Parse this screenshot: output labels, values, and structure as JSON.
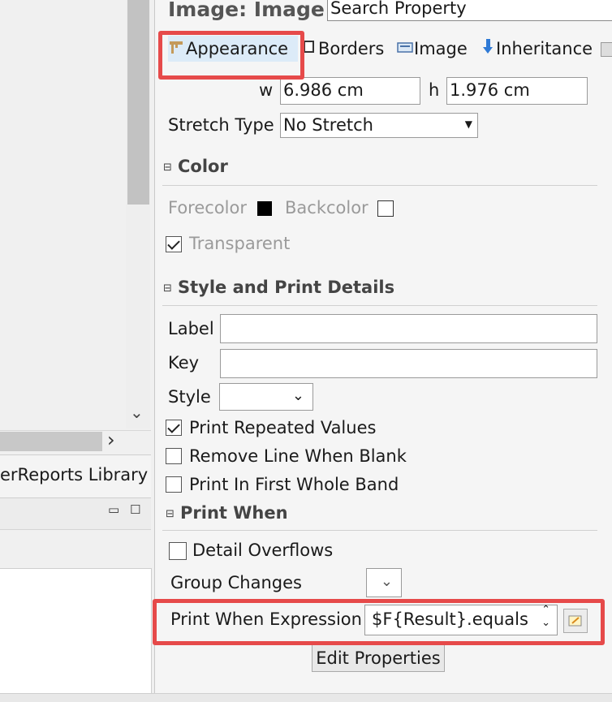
{
  "left": {
    "library_tab_label": "erReports Library",
    "scroll_down_glyph": "⌄",
    "scroll_right_glyph": "›",
    "minimize_glyph": "▭",
    "maximize_glyph": "☐"
  },
  "panel": {
    "title": "Image: Image",
    "search_placeholder": "Search Property"
  },
  "tabs": [
    {
      "label": "Appearance",
      "icon": "appearance-icon",
      "active": true
    },
    {
      "label": "Borders",
      "icon": "borders-icon",
      "active": false
    },
    {
      "label": "Image",
      "icon": "image-icon",
      "active": false
    },
    {
      "label": "Inheritance",
      "icon": "inheritance-icon",
      "active": false
    }
  ],
  "size": {
    "w_label": "w",
    "w_value": "6.986 cm",
    "h_label": "h",
    "h_value": "1.976 cm"
  },
  "stretch": {
    "label": "Stretch Type",
    "value": "No Stretch"
  },
  "color_section": {
    "title": "Color",
    "forecolor_label": "Forecolor",
    "forecolor_value": "#000000",
    "backcolor_label": "Backcolor",
    "backcolor_value": "#ffffff",
    "transparent_label": "Transparent",
    "transparent_checked": true
  },
  "style_section": {
    "title": "Style and Print Details",
    "label_label": "Label",
    "label_value": "",
    "key_label": "Key",
    "key_value": "",
    "style_label": "Style",
    "style_value": "",
    "print_repeated_label": "Print Repeated Values",
    "print_repeated_checked": true,
    "remove_line_label": "Remove Line When Blank",
    "remove_line_checked": false,
    "print_first_label": "Print In First Whole Band",
    "print_first_checked": false
  },
  "print_when_section": {
    "title": "Print When",
    "detail_overflows_label": "Detail Overflows",
    "detail_overflows_checked": false,
    "group_changes_label": "Group Changes",
    "group_changes_value": "",
    "expression_label": "Print When Expression",
    "expression_value": "$F{Result}.equals",
    "edit_properties_label": "Edit Properties"
  },
  "highlight_color": "#e64a4a"
}
